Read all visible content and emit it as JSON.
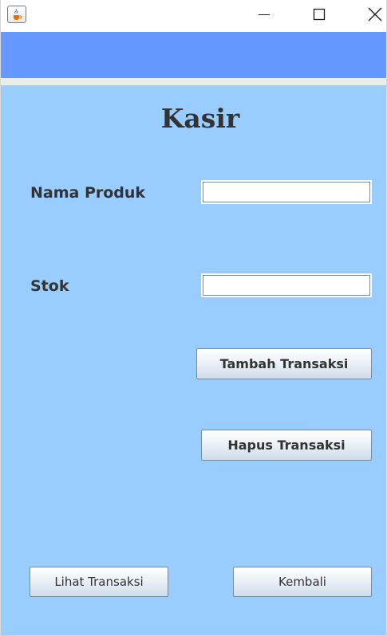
{
  "window": {
    "minimize_icon": "minimize-icon",
    "maximize_icon": "maximize-icon",
    "close_icon": "close-icon",
    "app_icon": "java-cup-icon"
  },
  "header": {
    "band_color": "#6699ff"
  },
  "form": {
    "background_color": "#99ccff",
    "title": "Kasir",
    "nama_produk_label": "Nama Produk",
    "nama_produk_value": "",
    "stok_label": "Stok",
    "stok_value": ""
  },
  "buttons": {
    "tambah": "Tambah Transaksi",
    "hapus": "Hapus Transaksi",
    "lihat": "Lihat Transaksi",
    "kembali": "Kembali"
  }
}
